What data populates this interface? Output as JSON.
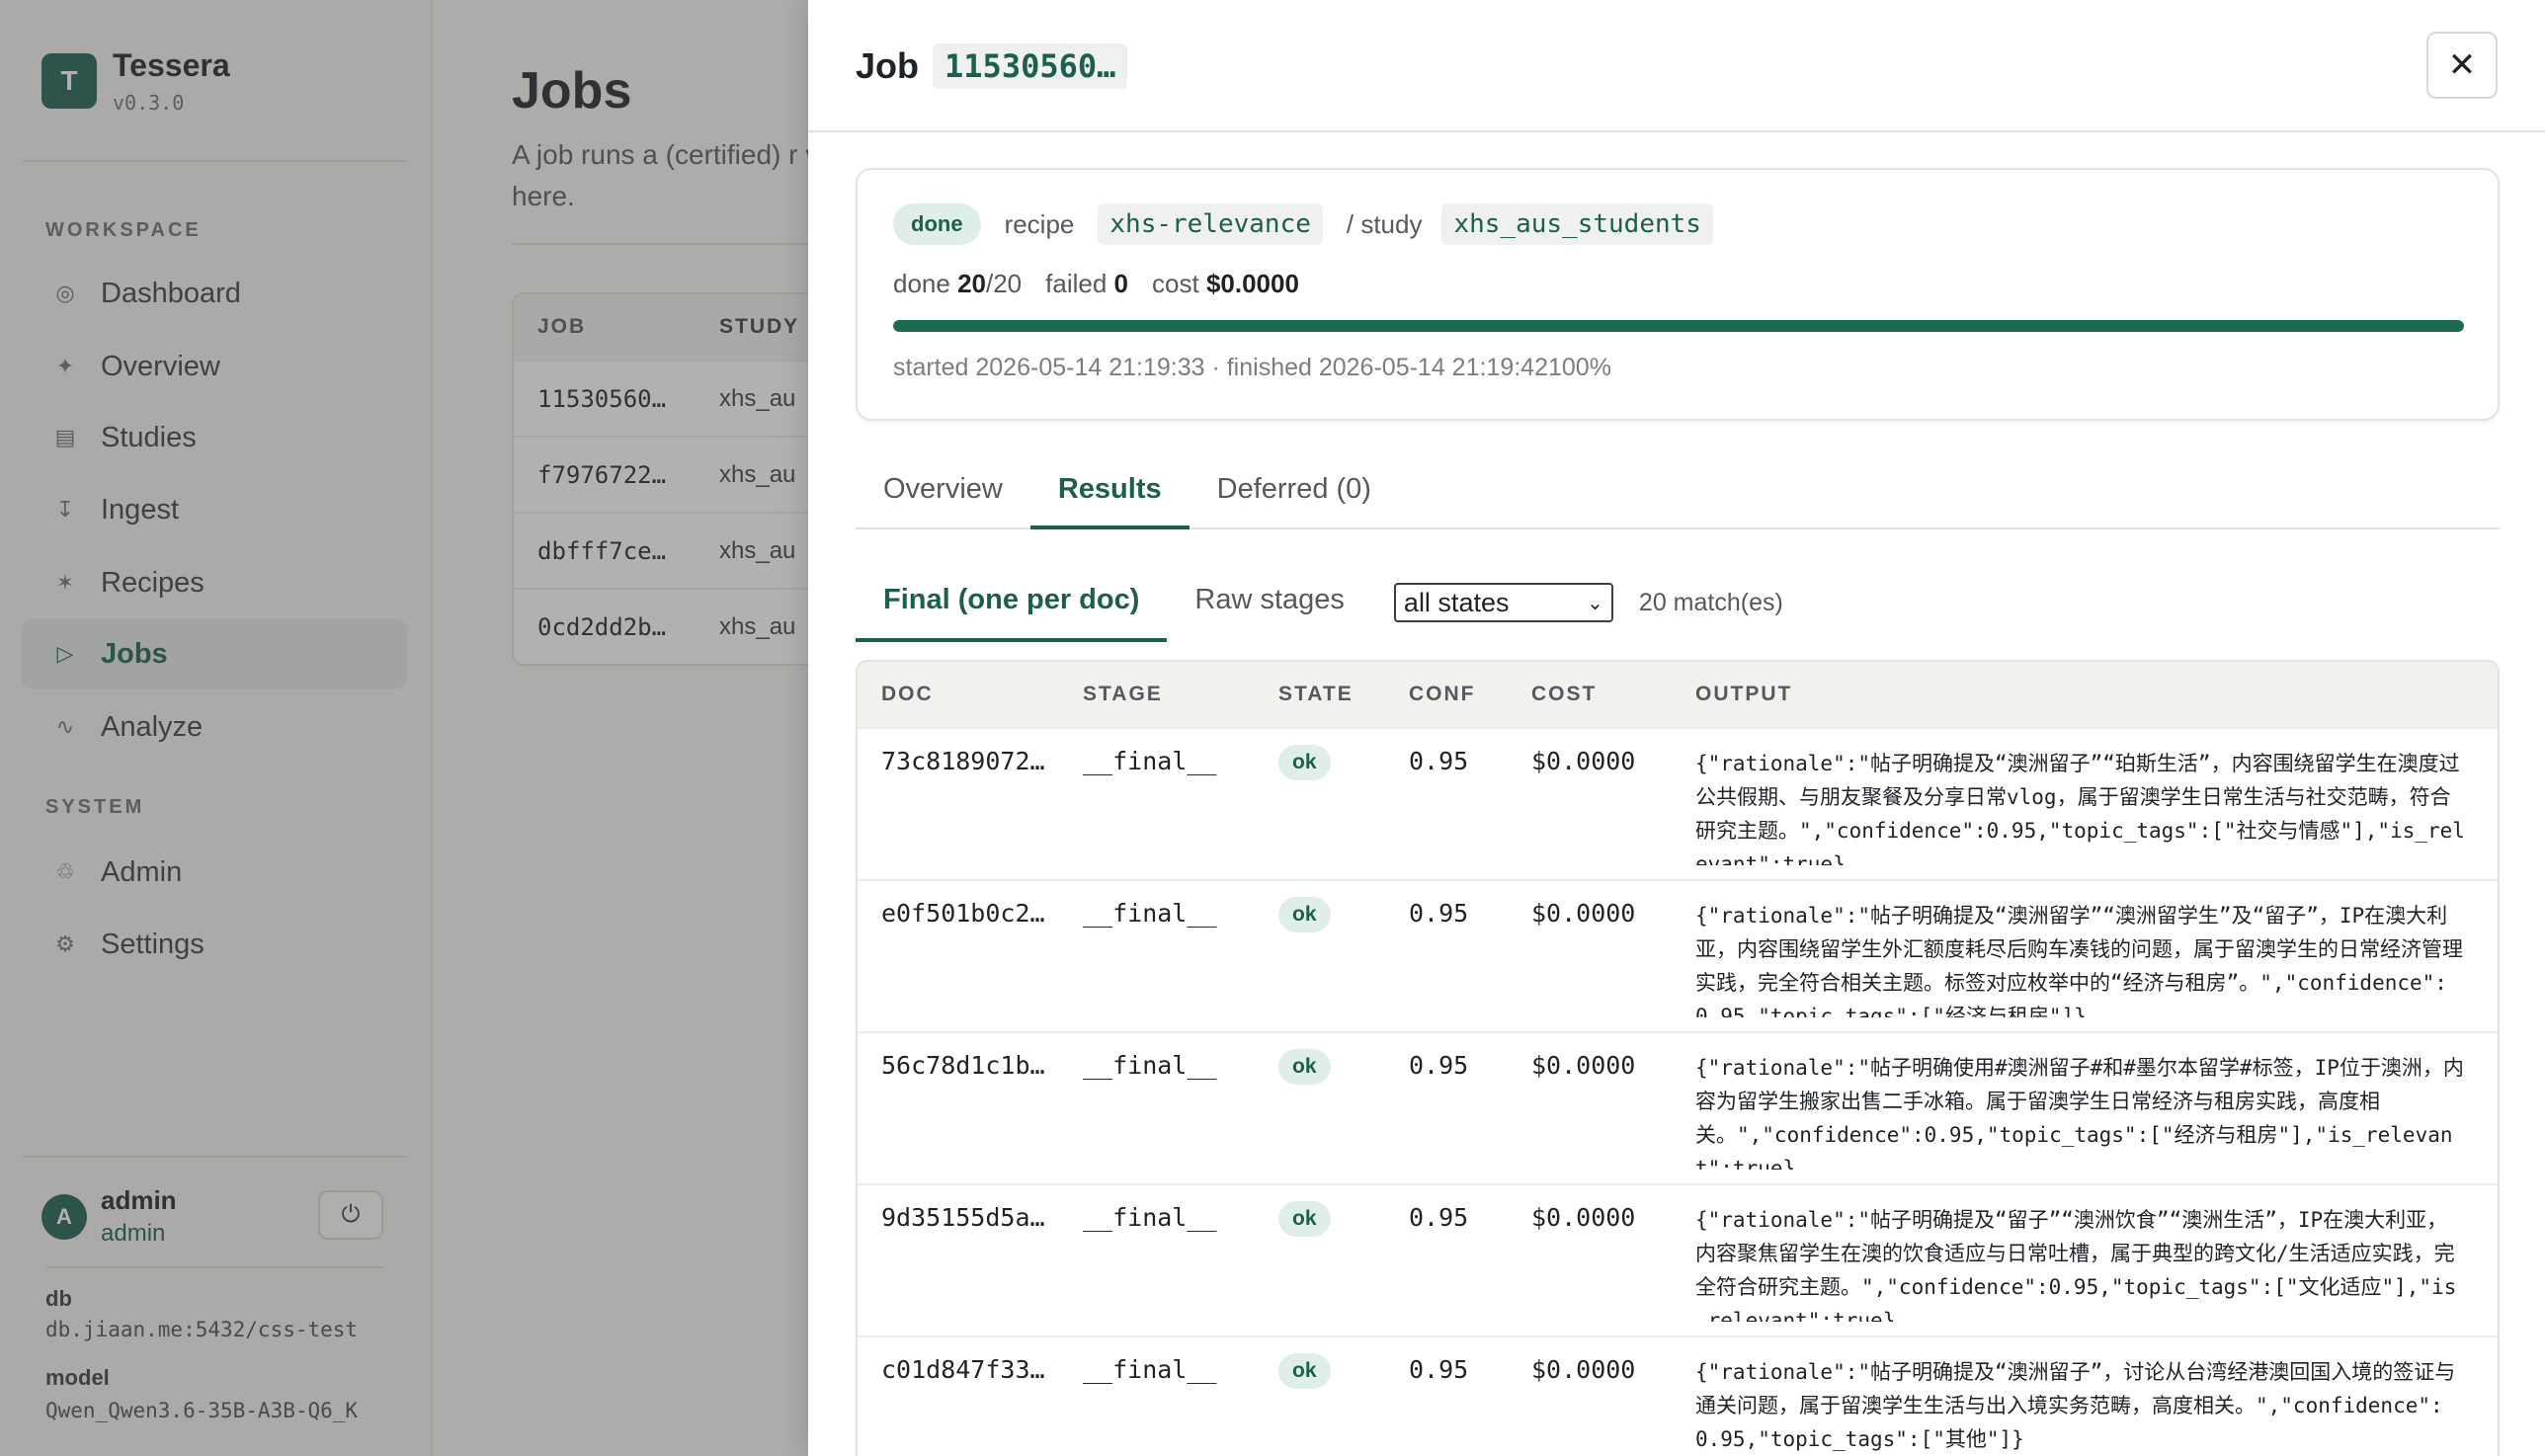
{
  "brand": {
    "logo_letter": "T",
    "name": "Tessera",
    "version": "v0.3.0"
  },
  "sidebar": {
    "workspace_label": "WORKSPACE",
    "system_label": "SYSTEM",
    "workspace_items": [
      {
        "label": "Dashboard",
        "icon": "◎"
      },
      {
        "label": "Overview",
        "icon": "✦"
      },
      {
        "label": "Studies",
        "icon": "▤"
      },
      {
        "label": "Ingest",
        "icon": "↧"
      },
      {
        "label": "Recipes",
        "icon": "✶"
      },
      {
        "label": "Jobs",
        "icon": "▷"
      },
      {
        "label": "Analyze",
        "icon": "∿"
      }
    ],
    "system_items": [
      {
        "label": "Admin",
        "icon": "♲"
      },
      {
        "label": "Settings",
        "icon": "⚙"
      }
    ],
    "user": {
      "initial": "A",
      "name": "admin",
      "role": "admin",
      "power_icon": "⏻"
    },
    "db_label": "db",
    "db_value": "db.jiaan.me:5432/css-test",
    "model_label": "model",
    "model_value": "Qwen_Qwen3.6-35B-A3B-Q6_K"
  },
  "main": {
    "title": "Jobs",
    "desc": "A job runs a (certified) r visible here.",
    "table_headers": [
      "JOB",
      "STUDY"
    ],
    "rows": [
      {
        "job": "11530560…",
        "study": "xhs_au"
      },
      {
        "job": "f7976722…",
        "study": "xhs_au"
      },
      {
        "job": "dbfff7ce…",
        "study": "xhs_au"
      },
      {
        "job": "0cd2dd2b…",
        "study": "xhs_au"
      }
    ]
  },
  "drawer": {
    "title": "Job",
    "job_id": "11530560…",
    "close_icon": "✕",
    "summary": {
      "status": "done",
      "recipe_label": "recipe",
      "recipe": "xhs-relevance",
      "study_label": "/ study",
      "study": "xhs_aus_students",
      "done_label": "done",
      "done_count": "20",
      "done_total": "/20",
      "failed_label": "failed",
      "failed_count": "0",
      "cost_label": "cost",
      "cost_value": "$0.0000",
      "progress_percent": 100,
      "timeline": "started 2026-05-14 21:19:33 · finished 2026-05-14 21:19:42100%"
    },
    "tabs": [
      "Overview",
      "Results",
      "Deferred (0)"
    ],
    "subtabs": [
      "Final (one per doc)",
      "Raw stages"
    ],
    "state_filter": "all states",
    "match_count": "20 match(es)",
    "result_headers": [
      "DOC",
      "STAGE",
      "STATE",
      "CONF",
      "COST",
      "OUTPUT"
    ],
    "results": [
      {
        "doc": "73c8189072…",
        "stage": "__final__",
        "state": "ok",
        "conf": "0.95",
        "cost": "$0.0000",
        "output": "{\"rationale\":\"帖子明确提及“澳洲留子”“珀斯生活”，内容围绕留学生在澳度过公共假期、与朋友聚餐及分享日常vlog，属于留澳学生日常生活与社交范畴，符合研究主题。\",\"confidence\":0.95,\"topic_tags\":[\"社交与情感\"],\"is_relevant\":true}"
      },
      {
        "doc": "e0f501b0c2…",
        "stage": "__final__",
        "state": "ok",
        "conf": "0.95",
        "cost": "$0.0000",
        "output": "{\"rationale\":\"帖子明确提及“澳洲留学”“澳洲留学生”及“留子”，IP在澳大利亚，内容围绕留学生外汇额度耗尽后购车凑钱的问题，属于留澳学生的日常经济管理实践，完全符合相关主题。标签对应枚举中的“经济与租房”。\",\"confidence\":0.95,\"topic_tags\":[\"经济与租房\"]}"
      },
      {
        "doc": "56c78d1c1b…",
        "stage": "__final__",
        "state": "ok",
        "conf": "0.95",
        "cost": "$0.0000",
        "output": "{\"rationale\":\"帖子明确使用#澳洲留子#和#墨尔本留学#标签，IP位于澳洲，内容为留学生搬家出售二手冰箱。属于留澳学生日常经济与租房实践，高度相关。\",\"confidence\":0.95,\"topic_tags\":[\"经济与租房\"],\"is_relevant\":true}"
      },
      {
        "doc": "9d35155d5a…",
        "stage": "__final__",
        "state": "ok",
        "conf": "0.95",
        "cost": "$0.0000",
        "output": "{\"rationale\":\"帖子明确提及“留子”“澳洲饮食”“澳洲生活”，IP在澳大利亚，内容聚焦留学生在澳的饮食适应与日常吐槽，属于典型的跨文化/生活适应实践，完全符合研究主题。\",\"confidence\":0.95,\"topic_tags\":[\"文化适应\"],\"is_relevant\":true}"
      },
      {
        "doc": "c01d847f33…",
        "stage": "__final__",
        "state": "ok",
        "conf": "0.95",
        "cost": "$0.0000",
        "output": "{\"rationale\":\"帖子明确提及“澳洲留子”，讨论从台湾经港澳回国入境的签证与通关问题，属于留澳学生生活与出入境实务范畴，高度相关。\",\"confidence\":0.95,\"topic_tags\":[\"其他\"]}"
      }
    ]
  }
}
